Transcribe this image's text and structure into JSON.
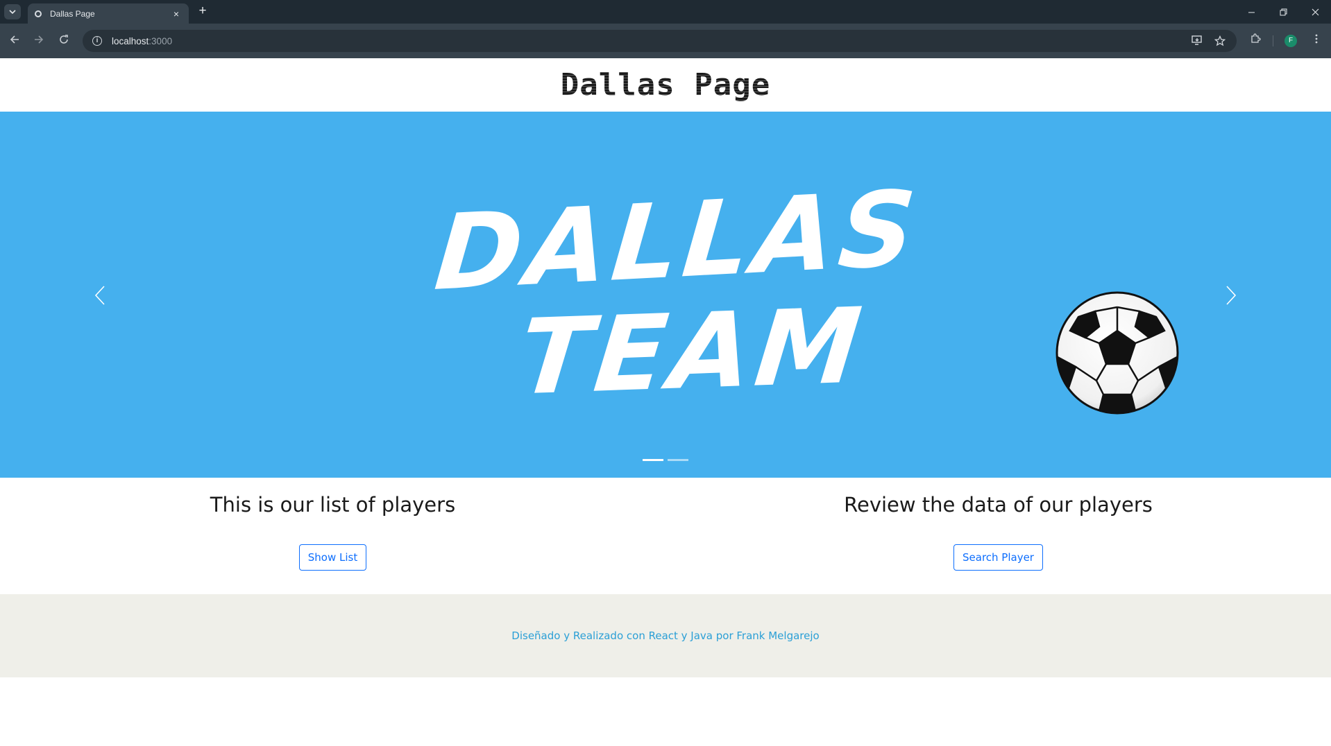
{
  "browser": {
    "tab_title": "Dallas Page",
    "tab_close_icon": "×",
    "new_tab_icon": "+",
    "url_host": "localhost",
    "url_port": ":3000",
    "profile_initial": "F"
  },
  "page": {
    "title": "Dallas Page",
    "carousel": {
      "line1": "DALLAS",
      "line2": "TEAM",
      "slide_count": 2,
      "active_slide": 1,
      "background": "#45b0ee"
    },
    "sections": [
      {
        "heading": "This is our list of players",
        "button_label": "Show List"
      },
      {
        "heading": "Review the data of our players",
        "button_label": "Search Player"
      }
    ],
    "footer_text": "Diseñado y Realizado con React y Java por Frank Melgarejo"
  },
  "colors": {
    "accent": "#0d6efd",
    "footer_link": "#2b9fd6",
    "footer_bg": "#efefe9"
  }
}
